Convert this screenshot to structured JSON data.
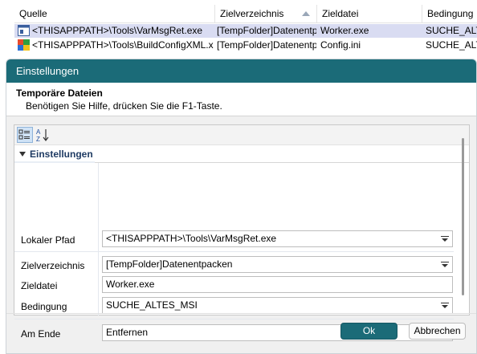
{
  "list": {
    "columns": [
      "Quelle",
      "Zielverzeichnis",
      "Zieldatei",
      "Bedingung"
    ],
    "rows": [
      {
        "quelle": "<THISAPPPATH>\\Tools\\VarMsgRet.exe",
        "zielverzeichnis": "[TempFolder]Datenentp...",
        "zieldatei": "Worker.exe",
        "bedingung": "SUCHE_ALTE",
        "selected": true
      },
      {
        "quelle": "<THISAPPPATH>\\Tools\\BuildConfigXML.xml",
        "zielverzeichnis": "[TempFolder]Datenentp...",
        "zieldatei": "Config.ini",
        "bedingung": "SUCHE_ALTE",
        "selected": false
      }
    ]
  },
  "dialog": {
    "title": "Einstellungen",
    "info_title": "Temporäre Dateien",
    "info_hint": "Benötigen Sie Hilfe, drücken Sie die F1-Taste.",
    "category": "Einstellungen",
    "properties": [
      {
        "label": "Lokaler Pfad",
        "value": "<THISAPPPATH>\\Tools\\VarMsgRet.exe",
        "dropdown": true
      },
      {
        "label": "Zielverzeichnis",
        "value": "[TempFolder]Datenentpacken",
        "dropdown": true
      },
      {
        "label": "Zieldatei",
        "value": "Worker.exe",
        "dropdown": false
      },
      {
        "label": "Bedingung",
        "value": "SUCHE_ALTES_MSI",
        "dropdown": true
      },
      {
        "label": "Am Ende",
        "value": "Entfernen",
        "dropdown": true
      }
    ],
    "buttons": {
      "ok": "Ok",
      "cancel": "Abbrechen"
    }
  },
  "colors": {
    "accent": "#1b6b78",
    "selection": "#d9dcf2"
  }
}
